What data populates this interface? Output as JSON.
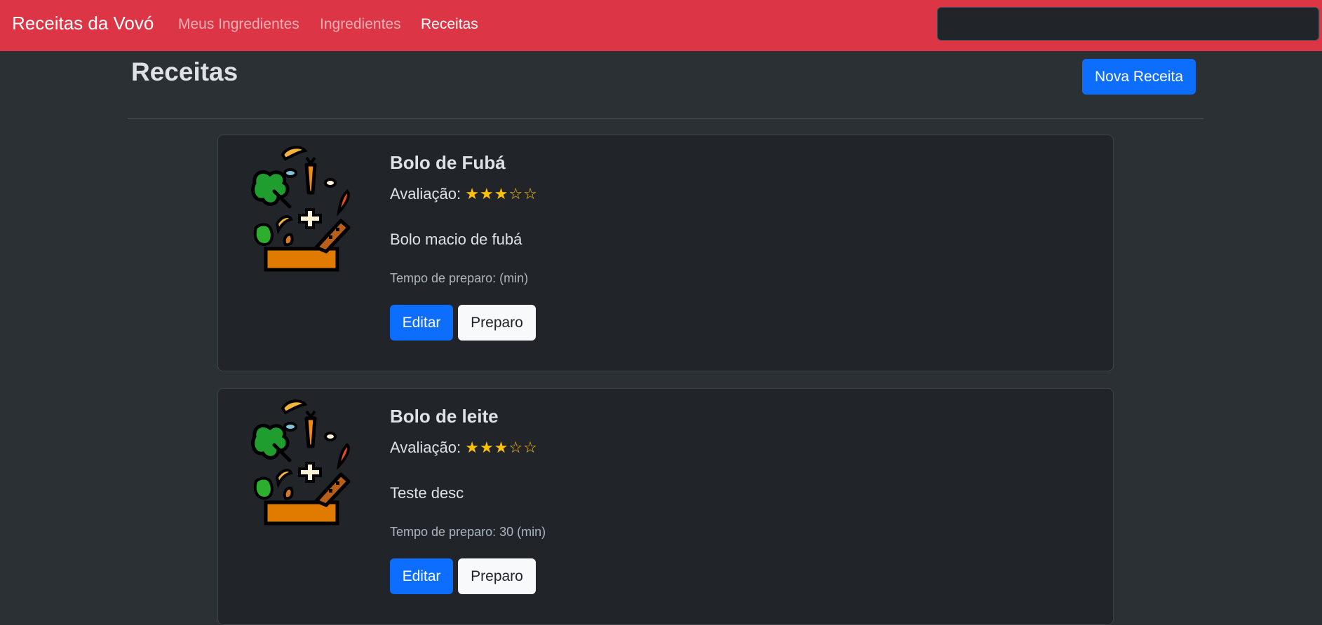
{
  "navbar": {
    "brand": "Receitas da Vovó",
    "links": [
      {
        "label": "Meus Ingredientes",
        "active": false
      },
      {
        "label": "Ingredientes",
        "active": false
      },
      {
        "label": "Receitas",
        "active": true
      }
    ],
    "search_value": ""
  },
  "page": {
    "title": "Receitas",
    "new_recipe_label": "Nova Receita"
  },
  "colors": {
    "navbar_bg": "#dc3545",
    "page_bg": "#2b3035",
    "card_bg": "#212529",
    "primary": "#0d6efd",
    "star": "#ffc107"
  },
  "recipes": [
    {
      "title": "Bolo de Fubá",
      "rating_label": "Avaliação:",
      "rating": 3,
      "rating_max": 5,
      "stars": "★★★☆☆",
      "description": "Bolo macio de fubá",
      "prep_label": "Tempo de preparo:",
      "prep_value": "(min)",
      "image_icon": "vegetables-cooking-pot-icon",
      "edit_label": "Editar",
      "prep_button_label": "Preparo"
    },
    {
      "title": "Bolo de leite",
      "rating_label": "Avaliação:",
      "rating": 3,
      "rating_max": 5,
      "stars": "★★★☆☆",
      "description": "Teste desc",
      "prep_label": "Tempo de preparo:",
      "prep_value": "30 (min)",
      "image_icon": "vegetables-cooking-pot-icon",
      "edit_label": "Editar",
      "prep_button_label": "Preparo"
    }
  ]
}
